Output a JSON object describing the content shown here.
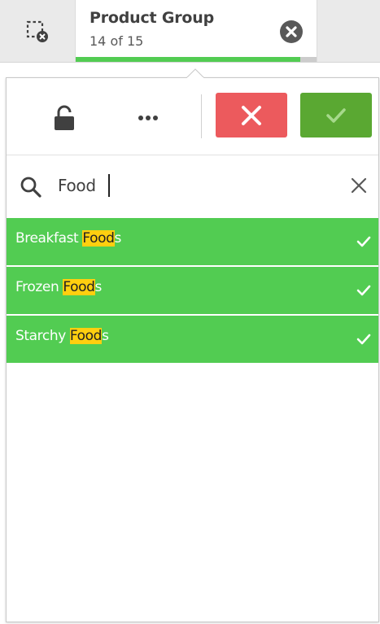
{
  "selection_bar": {
    "field_name": "Product Group",
    "selection_count": "14 of 15",
    "selected_fraction": 0.9333,
    "clear_all_icon": "clear-selections-icon",
    "chip_close_icon": "close-circle-icon"
  },
  "popover": {
    "toolbar": {
      "lock_icon": "unlock-icon",
      "more_icon": "more-icon",
      "cancel_icon": "cross-icon",
      "confirm_icon": "check-icon"
    },
    "search": {
      "value": "Food",
      "search_icon": "search-icon",
      "clear_icon": "close-icon"
    },
    "items": [
      {
        "before": "Breakfast ",
        "match": "Food",
        "after": "s",
        "state": "selected"
      },
      {
        "before": "Frozen ",
        "match": "Food",
        "after": "s",
        "state": "selected"
      },
      {
        "before": "Starchy ",
        "match": "Food",
        "after": "s",
        "state": "selected"
      }
    ]
  },
  "colors": {
    "selected_green": "#52cc52",
    "confirm_green": "#5aa832",
    "cancel_red": "#ec5a5d",
    "highlight_yellow": "#ffcf0f"
  }
}
